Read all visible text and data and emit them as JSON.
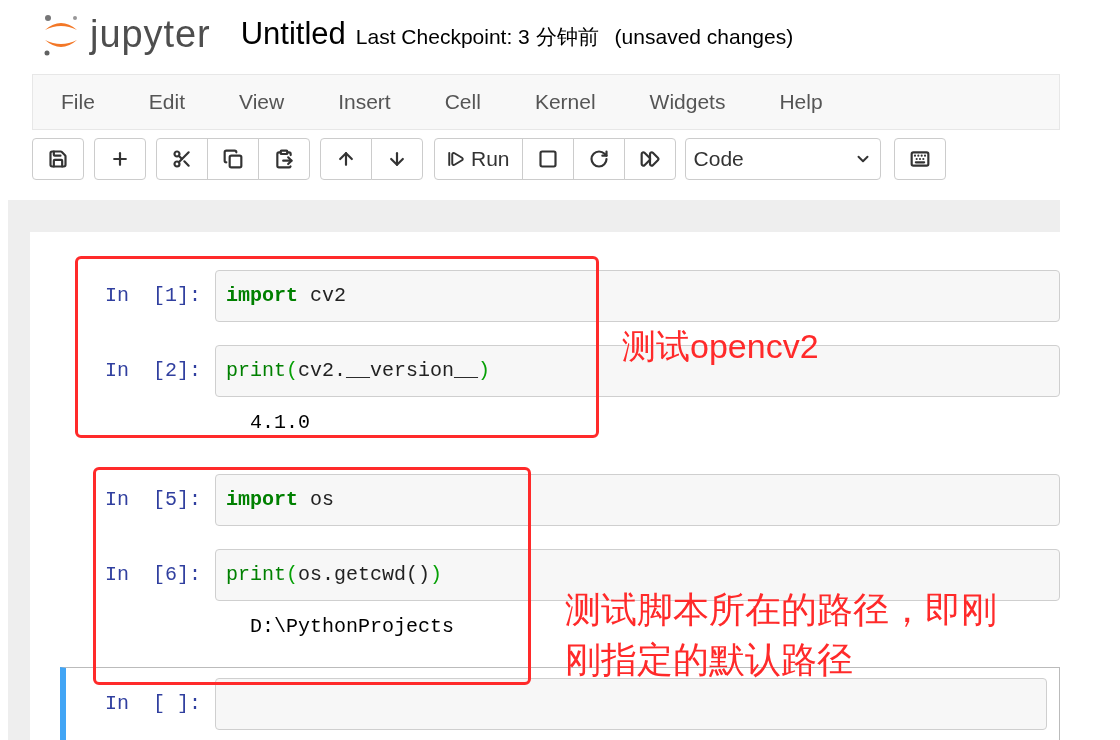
{
  "header": {
    "logo_text": "jupyter",
    "title": "Untitled",
    "checkpoint": "Last Checkpoint: 3 分钟前",
    "status": "(unsaved changes)"
  },
  "menu": [
    "File",
    "Edit",
    "View",
    "Insert",
    "Cell",
    "Kernel",
    "Widgets",
    "Help"
  ],
  "toolbar": {
    "run_label": "Run",
    "cell_type": "Code"
  },
  "cells": [
    {
      "prompt": "In  [1]:",
      "selected": false,
      "code": [
        {
          "kind": "keyword",
          "text": "import"
        },
        {
          "kind": "plain",
          "text": " cv2"
        }
      ]
    },
    {
      "prompt": "In  [2]:",
      "selected": false,
      "code": [
        {
          "kind": "builtin",
          "text": "print"
        },
        {
          "kind": "paren",
          "text": "("
        },
        {
          "kind": "plain",
          "text": "cv2.__version__"
        },
        {
          "kind": "paren",
          "text": ")"
        }
      ],
      "output": "4.1.0"
    },
    {
      "prompt": "In  [5]:",
      "selected": false,
      "code": [
        {
          "kind": "keyword",
          "text": "import"
        },
        {
          "kind": "plain",
          "text": " os"
        }
      ]
    },
    {
      "prompt": "In  [6]:",
      "selected": false,
      "code": [
        {
          "kind": "builtin",
          "text": "print"
        },
        {
          "kind": "paren",
          "text": "("
        },
        {
          "kind": "plain",
          "text": "os.getcwd()"
        },
        {
          "kind": "paren",
          "text": ")"
        }
      ],
      "output": "D:\\PythonProjects"
    },
    {
      "prompt": "In  [ ]:",
      "selected": true
    }
  ],
  "annotations": [
    {
      "text": "测试opencv2"
    },
    {
      "text": "测试脚本所在的路径，即刚刚指定的默认路径"
    }
  ]
}
